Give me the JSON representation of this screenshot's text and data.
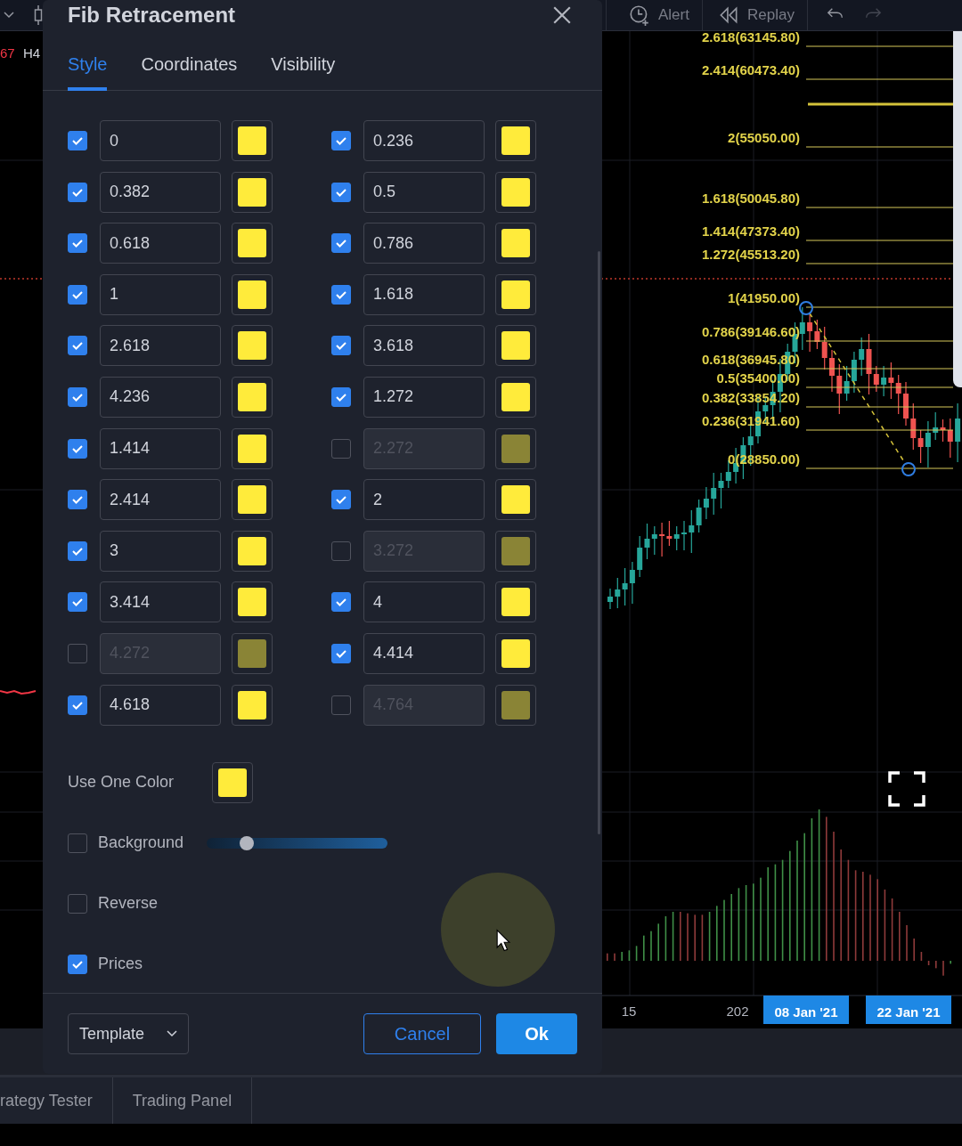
{
  "toolbar": {
    "buttons": [
      {
        "label": "Alert",
        "kind": "alert"
      },
      {
        "label": "Replay",
        "kind": "replay"
      }
    ]
  },
  "chart": {
    "legend": [
      {
        "text": "67",
        "kind": "down"
      },
      {
        "text": "H4",
        "kind": "plain"
      }
    ],
    "fib_labels": [
      "2.618(63145.80)",
      "2.414(60473.40)",
      "2(55050.00)",
      "1.618(50045.80)",
      "1.414(47373.40)",
      "1.272(45513.20)",
      "1(41950.00)",
      "0.786(39146.60)",
      "0.618(36945.80)",
      "0.5(35400.00)",
      "0.382(33854.20)",
      "0.236(31941.60)",
      "0(28850.00)"
    ],
    "time_axis": [
      {
        "label": "15",
        "selected": false
      },
      {
        "label": "202",
        "selected": false
      },
      {
        "label": "08 Jan '21",
        "selected": true
      },
      {
        "label": "22 Jan '21",
        "selected": true
      }
    ]
  },
  "dialog": {
    "title": "Fib Retracement",
    "tabs": [
      {
        "label": "Style",
        "selected": true
      },
      {
        "label": "Coordinates",
        "selected": false
      },
      {
        "label": "Visibility",
        "selected": false
      }
    ],
    "levels": [
      {
        "value": "0",
        "checked": true
      },
      {
        "value": "0.236",
        "checked": true
      },
      {
        "value": "0.382",
        "checked": true
      },
      {
        "value": "0.5",
        "checked": true
      },
      {
        "value": "0.618",
        "checked": true
      },
      {
        "value": "0.786",
        "checked": true
      },
      {
        "value": "1",
        "checked": true
      },
      {
        "value": "1.618",
        "checked": true
      },
      {
        "value": "2.618",
        "checked": true
      },
      {
        "value": "3.618",
        "checked": true
      },
      {
        "value": "4.236",
        "checked": true
      },
      {
        "value": "1.272",
        "checked": true
      },
      {
        "value": "1.414",
        "checked": true
      },
      {
        "value": "2.272",
        "checked": false
      },
      {
        "value": "2.414",
        "checked": true
      },
      {
        "value": "2",
        "checked": true
      },
      {
        "value": "3",
        "checked": true
      },
      {
        "value": "3.272",
        "checked": false
      },
      {
        "value": "3.414",
        "checked": true
      },
      {
        "value": "4",
        "checked": true
      },
      {
        "value": "4.272",
        "checked": false
      },
      {
        "value": "4.414",
        "checked": true
      },
      {
        "value": "4.618",
        "checked": true
      },
      {
        "value": "4.764",
        "checked": false
      }
    ],
    "use_one_color": {
      "label": "Use One Color"
    },
    "options": [
      {
        "label": "Background",
        "kind": "slider",
        "checked": false,
        "level": 0.22
      },
      {
        "label": "Reverse",
        "kind": "check",
        "checked": false
      },
      {
        "label": "Prices",
        "kind": "check",
        "checked": true
      }
    ],
    "footer": {
      "template": "Template",
      "cancel": "Cancel",
      "ok": "Ok"
    }
  },
  "bottom_tabs": [
    {
      "label": "rategy Tester"
    },
    {
      "label": "Trading Panel"
    }
  ]
}
